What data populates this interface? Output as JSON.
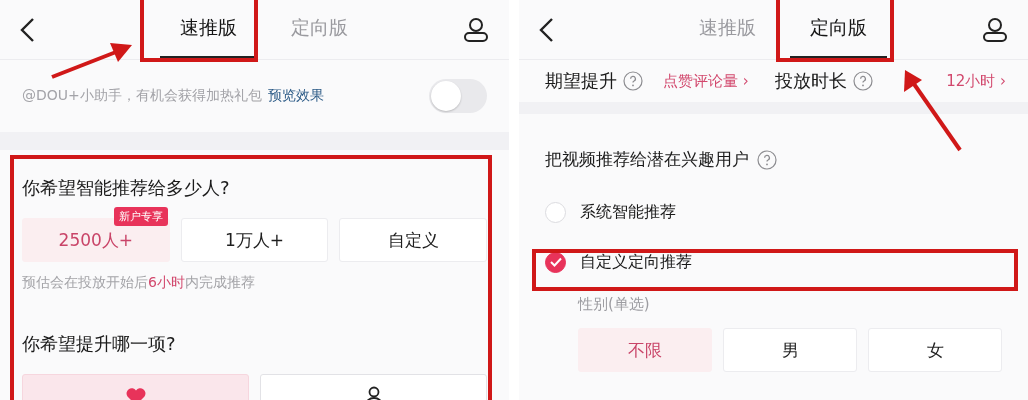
{
  "left_screen": {
    "tabs": [
      {
        "label": "速推版",
        "selected": true
      },
      {
        "label": "定向版",
        "selected": false
      }
    ],
    "notice": {
      "text": "@DOU+小助手，有机会获得加热礼包",
      "link": "预览效果",
      "on": false
    },
    "question_1": "你希望智能推荐给多少人?",
    "audience_options": [
      {
        "label": "2500人+",
        "selected": true,
        "badge": "新户专享"
      },
      {
        "label": "1万人+",
        "selected": false
      },
      {
        "label": "自定义",
        "selected": false
      }
    ],
    "hint": "预估会在投放开始后**6小时**内完成推荐",
    "question_2": "你希望提升哪一项?",
    "boost_options": [
      {
        "kind": "likes",
        "selected": true
      },
      {
        "kind": "profile",
        "selected": false
      }
    ]
  },
  "right_screen": {
    "tabs": [
      {
        "label": "速推版",
        "selected": false
      },
      {
        "label": "定向版",
        "selected": true
      }
    ],
    "settings": [
      {
        "label": "期望提升",
        "value": "点赞评论量 ›"
      },
      {
        "label": "投放时长",
        "value": "12小时 ›"
      }
    ],
    "section_title": "把视频推荐给潜在兴趣用户",
    "modes": [
      {
        "label": "系统智能推荐",
        "selected": false
      },
      {
        "label": "自定义定向推荐",
        "selected": true
      }
    ],
    "gender_label": "性别(单选)",
    "genders": [
      {
        "label": "不限",
        "selected": true
      },
      {
        "label": "男",
        "selected": false
      },
      {
        "label": "女",
        "selected": false
      }
    ]
  }
}
